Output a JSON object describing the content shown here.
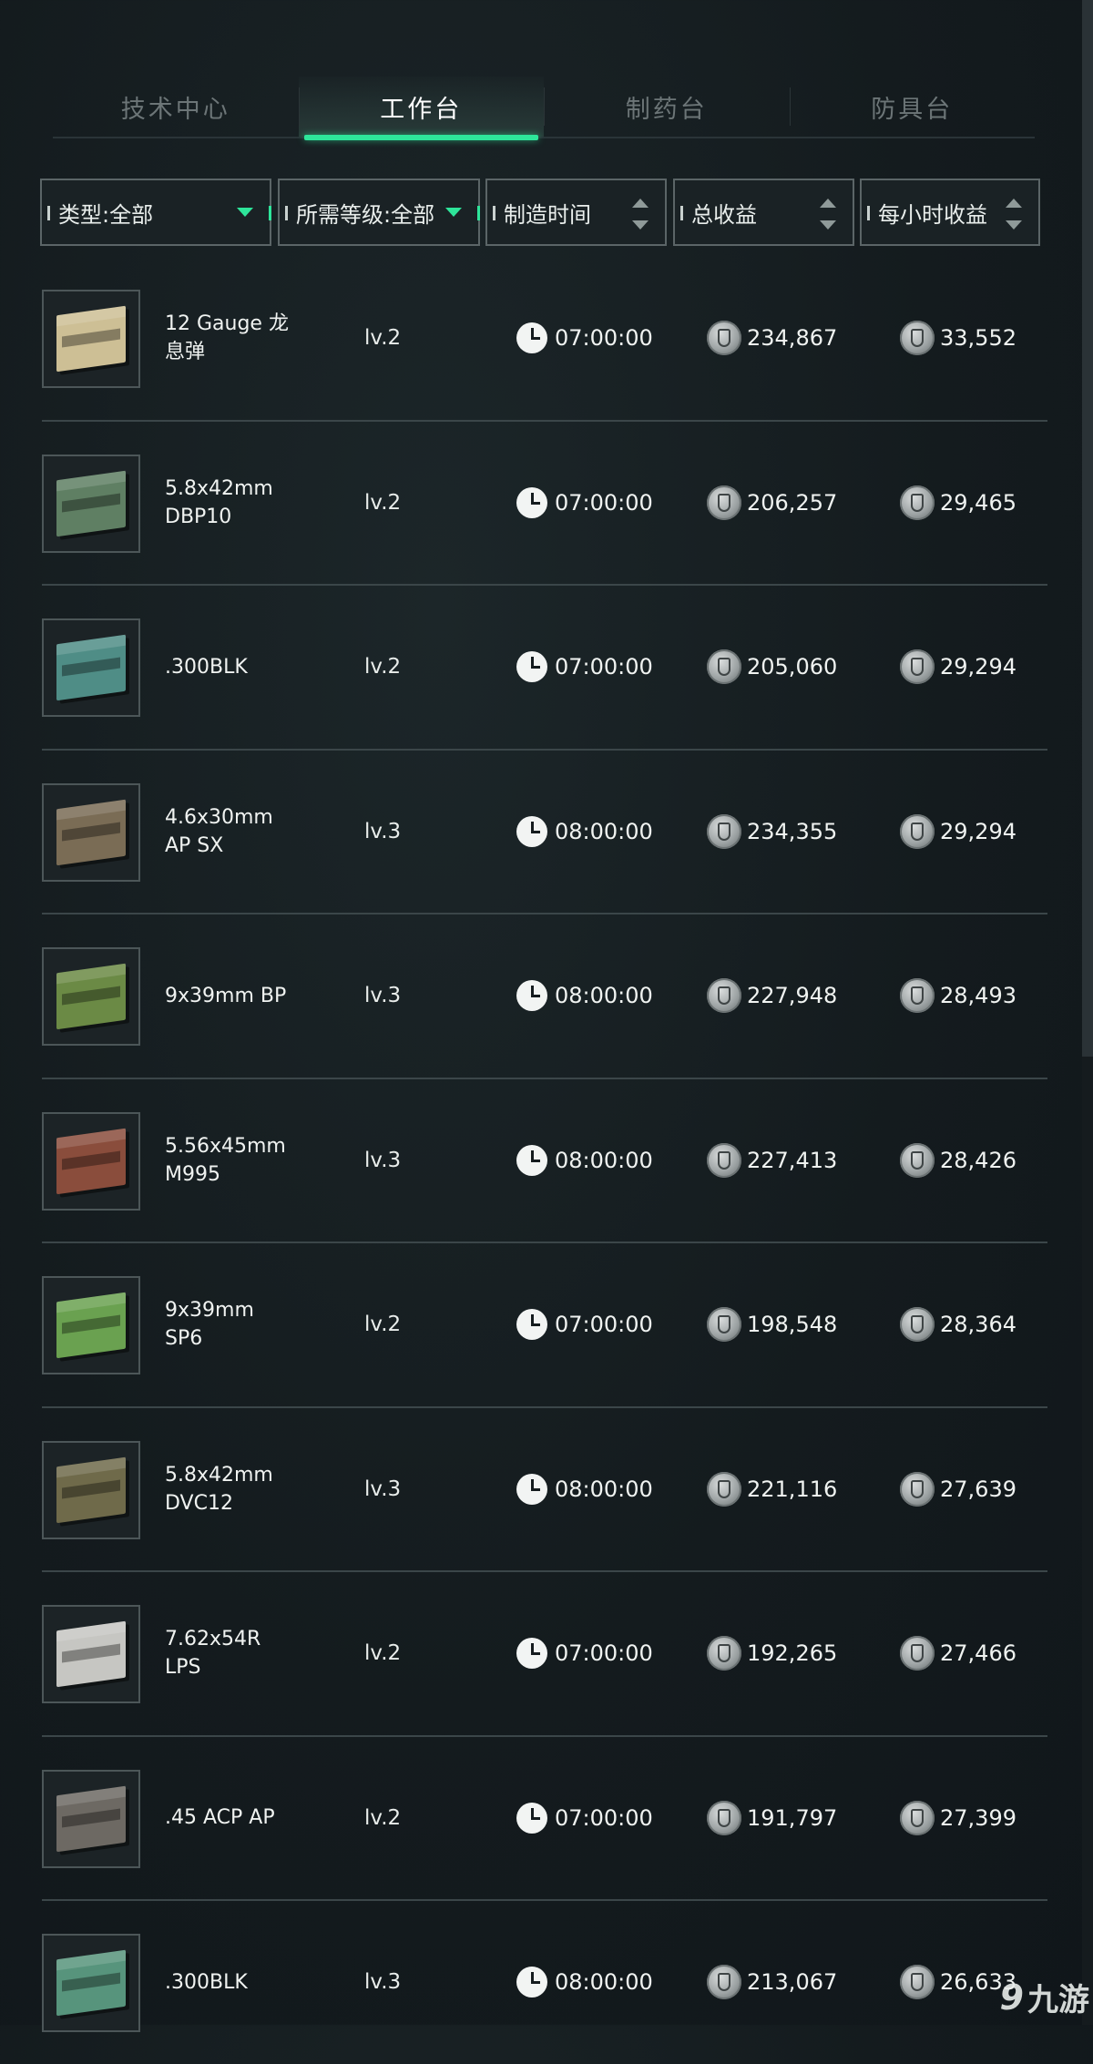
{
  "tabs": [
    {
      "label": "技术中心",
      "active": false
    },
    {
      "label": "工作台",
      "active": true
    },
    {
      "label": "制药台",
      "active": false
    },
    {
      "label": "防具台",
      "active": false
    }
  ],
  "filters": {
    "type": "类型:全部",
    "level": "所需等级:全部",
    "time": "制造时间",
    "total": "总收益",
    "hourly": "每小时收益"
  },
  "accent_color": "#2ee59a",
  "rows": [
    {
      "name": "12 Gauge 龙息弹",
      "level": "lv.2",
      "time": "07:00:00",
      "total": "234,867",
      "hourly": "33,552",
      "box_color": "#cdbf95"
    },
    {
      "name": "5.8x42mm DBP10",
      "level": "lv.2",
      "time": "07:00:00",
      "total": "206,257",
      "hourly": "29,465",
      "box_color": "#5f7f63"
    },
    {
      "name": ".300BLK",
      "level": "lv.2",
      "time": "07:00:00",
      "total": "205,060",
      "hourly": "29,294",
      "box_color": "#4f8d86"
    },
    {
      "name": "4.6x30mm AP SX",
      "level": "lv.3",
      "time": "08:00:00",
      "total": "234,355",
      "hourly": "29,294",
      "box_color": "#7a6c55"
    },
    {
      "name": "9x39mm BP",
      "level": "lv.3",
      "time": "08:00:00",
      "total": "227,948",
      "hourly": "28,493",
      "box_color": "#6b8a45"
    },
    {
      "name": "5.56x45mm M995",
      "level": "lv.3",
      "time": "08:00:00",
      "total": "227,413",
      "hourly": "28,426",
      "box_color": "#8a4d3c"
    },
    {
      "name": "9x39mm SP6",
      "level": "lv.2",
      "time": "07:00:00",
      "total": "198,548",
      "hourly": "28,364",
      "box_color": "#6aa150"
    },
    {
      "name": "5.8x42mm DVC12",
      "level": "lv.3",
      "time": "08:00:00",
      "total": "221,116",
      "hourly": "27,639",
      "box_color": "#6f6a4a"
    },
    {
      "name": "7.62x54R LPS",
      "level": "lv.2",
      "time": "07:00:00",
      "total": "192,265",
      "hourly": "27,466",
      "box_color": "#c6c6c2"
    },
    {
      "name": ".45 ACP AP",
      "level": "lv.2",
      "time": "07:00:00",
      "total": "191,797",
      "hourly": "27,399",
      "box_color": "#6d6963"
    },
    {
      "name": ".300BLK",
      "level": "lv.3",
      "time": "08:00:00",
      "total": "213,067",
      "hourly": "26,633",
      "box_color": "#57947c"
    }
  ],
  "watermark": {
    "mark": "9",
    "text": "九游"
  }
}
